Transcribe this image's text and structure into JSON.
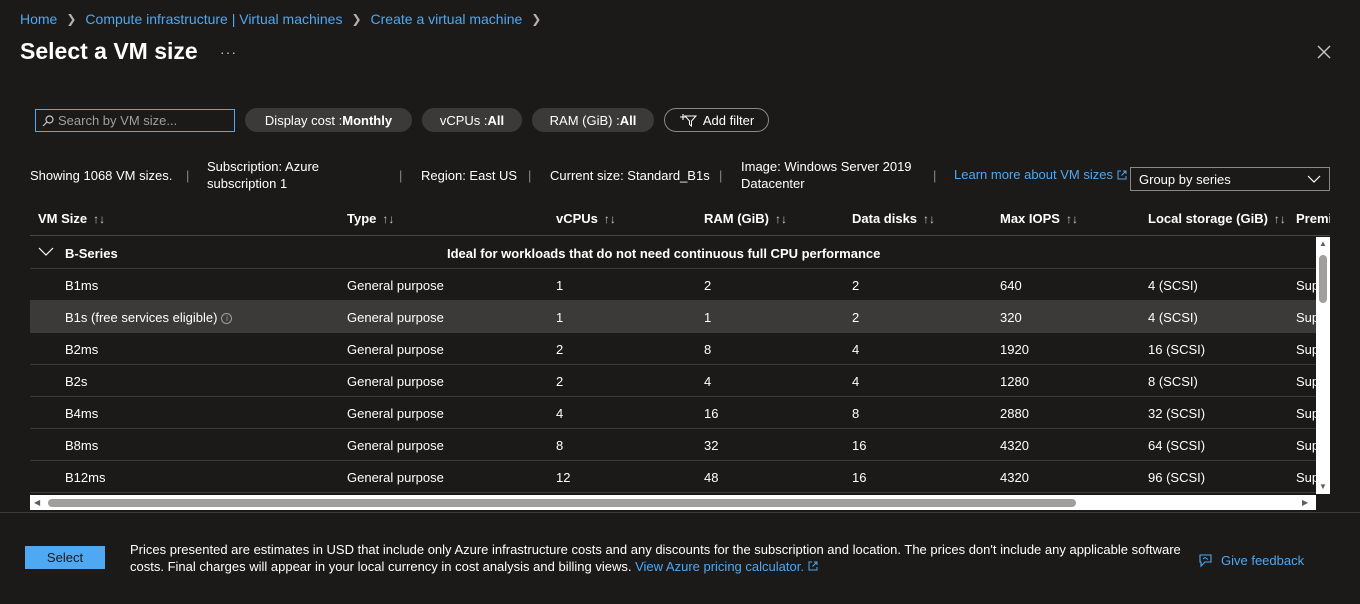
{
  "breadcrumb": [
    {
      "label": "Home"
    },
    {
      "label": "Compute infrastructure | Virtual machines"
    },
    {
      "label": "Create a virtual machine"
    }
  ],
  "title": "Select a VM size",
  "more_label": "···",
  "search": {
    "placeholder": "Search by VM size...",
    "value": ""
  },
  "filters": {
    "display_cost": {
      "label": "Display cost : ",
      "value": "Monthly"
    },
    "vcpus": {
      "label": "vCPUs : ",
      "value": "All"
    },
    "ram": {
      "label": "RAM (GiB) : ",
      "value": "All"
    },
    "add_filter": "Add filter"
  },
  "info_bar": {
    "showing": "Showing 1068 VM sizes.",
    "subscription_line1": "Subscription: Azure",
    "subscription_line2": "subscription 1",
    "region": "Region: East US",
    "current_size": "Current size: Standard_B1s",
    "image_line1": "Image: Windows Server 2019",
    "image_line2": "Datacenter",
    "separator": "|",
    "learn_more": "Learn more about VM sizes",
    "group_by": "Group by series"
  },
  "table": {
    "columns": [
      "VM Size",
      "Type",
      "vCPUs",
      "RAM (GiB)",
      "Data disks",
      "Max IOPS",
      "Local storage (GiB)",
      "Premi"
    ],
    "sort_glyph": "↑↓",
    "group": {
      "name": "B-Series",
      "description": "Ideal for workloads that do not need continuous full CPU performance"
    },
    "rows": [
      {
        "size": "B1ms",
        "type": "General purpose",
        "vcpus": "1",
        "ram": "2",
        "disks": "2",
        "iops": "640",
        "storage": "4 (SCSI)",
        "premium": "Sup"
      },
      {
        "size": "B1s (free services eligible)",
        "type": "General purpose",
        "vcpus": "1",
        "ram": "1",
        "disks": "2",
        "iops": "320",
        "storage": "4 (SCSI)",
        "premium": "Sup"
      },
      {
        "size": "B2ms",
        "type": "General purpose",
        "vcpus": "2",
        "ram": "8",
        "disks": "4",
        "iops": "1920",
        "storage": "16 (SCSI)",
        "premium": "Sup"
      },
      {
        "size": "B2s",
        "type": "General purpose",
        "vcpus": "2",
        "ram": "4",
        "disks": "4",
        "iops": "1280",
        "storage": "8 (SCSI)",
        "premium": "Sup"
      },
      {
        "size": "B4ms",
        "type": "General purpose",
        "vcpus": "4",
        "ram": "16",
        "disks": "8",
        "iops": "2880",
        "storage": "32 (SCSI)",
        "premium": "Sup"
      },
      {
        "size": "B8ms",
        "type": "General purpose",
        "vcpus": "8",
        "ram": "32",
        "disks": "16",
        "iops": "4320",
        "storage": "64 (SCSI)",
        "premium": "Sup"
      },
      {
        "size": "B12ms",
        "type": "General purpose",
        "vcpus": "12",
        "ram": "48",
        "disks": "16",
        "iops": "4320",
        "storage": "96 (SCSI)",
        "premium": "Sup"
      }
    ]
  },
  "footer": {
    "select_label": "Select",
    "notice": "Prices presented are estimates in USD that include only Azure infrastructure costs and any discounts for the subscription and location. The prices don't include any applicable software costs. Final charges will appear in your local currency in cost analysis and billing views.",
    "pricing_link": "View Azure pricing calculator.",
    "feedback": "Give feedback"
  },
  "colors": {
    "accent": "#4ea8f2",
    "background": "#1b1a19",
    "selected_row": "#3b3a39"
  }
}
